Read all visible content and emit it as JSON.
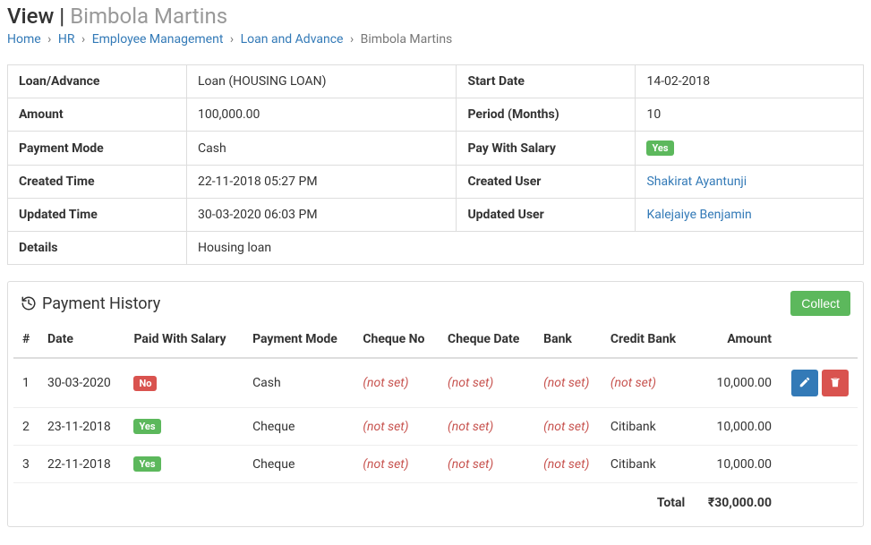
{
  "page": {
    "title_prefix": "View",
    "title_sep": " | ",
    "title_name": "Bimbola Martins"
  },
  "breadcrumb": {
    "home": "Home",
    "hr": "HR",
    "emp_mgmt": "Employee Management",
    "loan_adv": "Loan and Advance",
    "current": "Bimbola Martins",
    "sep": "›"
  },
  "detail": {
    "loan_advance_label": "Loan/Advance",
    "loan_advance_value": "Loan (HOUSING LOAN)",
    "start_date_label": "Start Date",
    "start_date_value": "14-02-2018",
    "amount_label": "Amount",
    "amount_value": "100,000.00",
    "period_label": "Period (Months)",
    "period_value": "10",
    "payment_mode_label": "Payment Mode",
    "payment_mode_value": "Cash",
    "pay_with_salary_label": "Pay With Salary",
    "pay_with_salary_badge": "Yes",
    "created_time_label": "Created Time",
    "created_time_value": "22-11-2018 05:27 PM",
    "created_user_label": "Created User",
    "created_user_value": "Shakirat Ayantunji",
    "updated_time_label": "Updated Time",
    "updated_time_value": "30-03-2020 06:03 PM",
    "updated_user_label": "Updated User",
    "updated_user_value": "Kalejaiye Benjamin",
    "details_label": "Details",
    "details_value": "Housing loan"
  },
  "history": {
    "title": "Payment History",
    "collect_btn": "Collect",
    "not_set": "(not set)",
    "headers": {
      "num": "#",
      "date": "Date",
      "paid_with_salary": "Paid With Salary",
      "payment_mode": "Payment Mode",
      "cheque_no": "Cheque No",
      "cheque_date": "Cheque Date",
      "bank": "Bank",
      "credit_bank": "Credit Bank",
      "amount": "Amount"
    },
    "rows": [
      {
        "num": "1",
        "date": "30-03-2020",
        "pws_badge": "No",
        "payment_mode": "Cash",
        "cheque_no": null,
        "cheque_date": null,
        "bank": null,
        "credit_bank": null,
        "amount": "10,000.00",
        "actions": true
      },
      {
        "num": "2",
        "date": "23-11-2018",
        "pws_badge": "Yes",
        "payment_mode": "Cheque",
        "cheque_no": null,
        "cheque_date": null,
        "bank": null,
        "credit_bank": "Citibank",
        "amount": "10,000.00",
        "actions": false
      },
      {
        "num": "3",
        "date": "22-11-2018",
        "pws_badge": "Yes",
        "payment_mode": "Cheque",
        "cheque_no": null,
        "cheque_date": null,
        "bank": null,
        "credit_bank": "Citibank",
        "amount": "10,000.00",
        "actions": false
      }
    ],
    "total_label": "Total",
    "total_value": "₹30,000.00"
  }
}
